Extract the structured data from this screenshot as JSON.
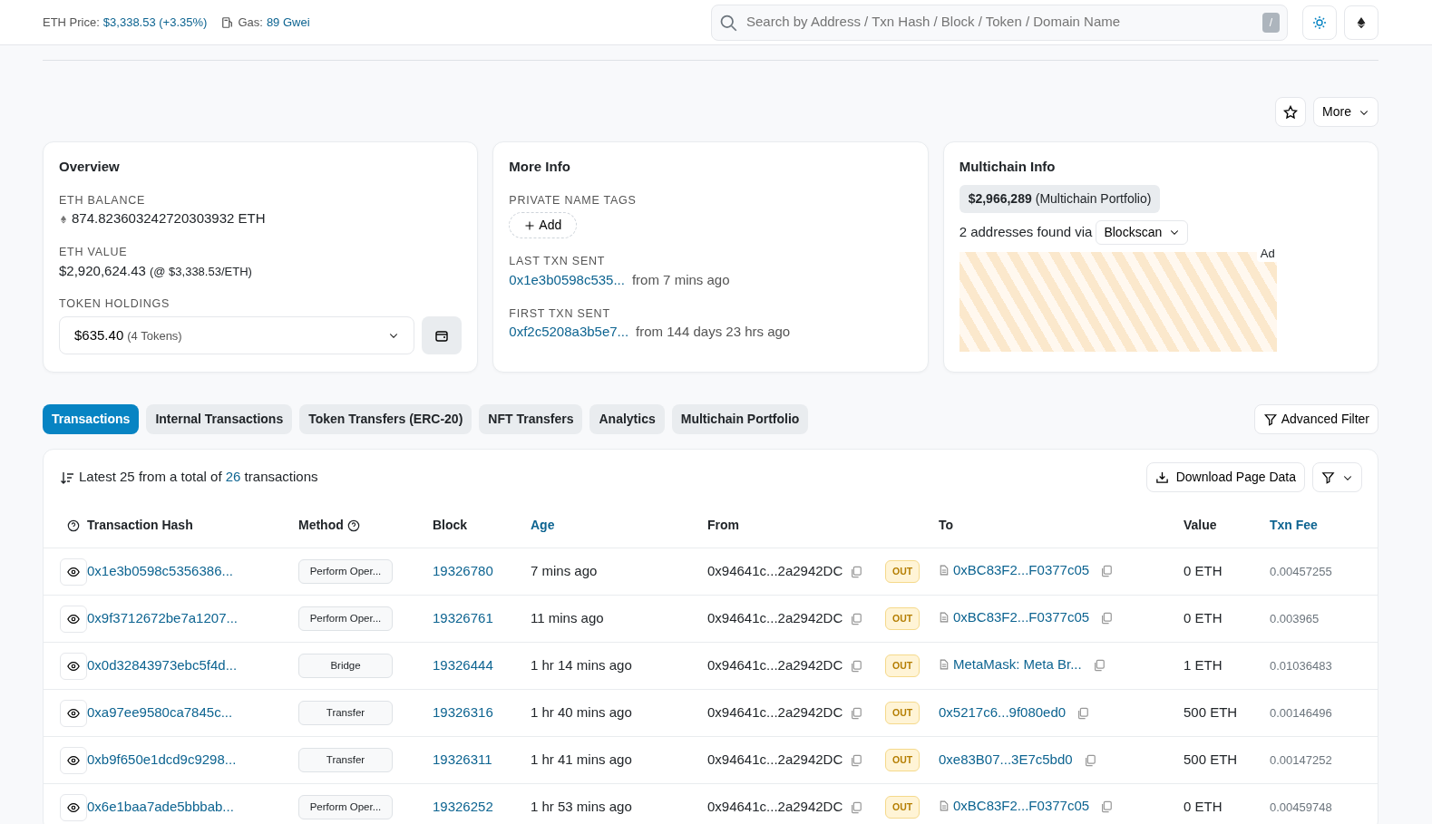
{
  "topbar": {
    "eth_price_label": "ETH Price:",
    "eth_price": "$3,338.53 (+3.35%)",
    "gas_label": "Gas:",
    "gas": "89 Gwei",
    "search": {
      "placeholder": "Search by Address / Txn Hash / Block / Token / Domain Name",
      "shortcut": "/"
    }
  },
  "actions": {
    "more": "More"
  },
  "overview": {
    "title": "Overview",
    "balance_label": "ETH BALANCE",
    "balance": "874.823603242720303932 ETH",
    "value_label": "ETH VALUE",
    "value": "$2,920,624.43",
    "value_rate": "(@ $3,338.53/ETH)",
    "holdings_label": "TOKEN HOLDINGS",
    "holdings": "$635.40",
    "holdings_count": "(4 Tokens)"
  },
  "more_info": {
    "title": "More Info",
    "tags_label": "PRIVATE NAME TAGS",
    "add": "Add",
    "last_label": "LAST TXN SENT",
    "last_hash": "0x1e3b0598c535...",
    "last_age": "from 7 mins ago",
    "first_label": "FIRST TXN SENT",
    "first_hash": "0xf2c5208a3b5e7...",
    "first_age": "from 144 days 23 hrs ago"
  },
  "multichain": {
    "title": "Multichain Info",
    "portfolio_value": "$2,966,289",
    "portfolio_label": "(Multichain Portfolio)",
    "found": "2 addresses found via",
    "source": "Blockscan",
    "ad_label": "Ad"
  },
  "tabs": [
    {
      "label": "Transactions",
      "selected": true
    },
    {
      "label": "Internal Transactions",
      "selected": false
    },
    {
      "label": "Token Transfers (ERC-20)",
      "selected": false
    },
    {
      "label": "NFT Transfers",
      "selected": false
    },
    {
      "label": "Analytics",
      "selected": false
    },
    {
      "label": "Multichain Portfolio",
      "selected": false
    }
  ],
  "advanced_filter": "Advanced Filter",
  "table": {
    "summary_prefix": "Latest 25 from a total of",
    "summary_count": "26",
    "summary_suffix": "transactions",
    "download": "Download Page Data",
    "columns": [
      {
        "label": "Transaction Hash",
        "link": false
      },
      {
        "label": "Method",
        "link": false
      },
      {
        "label": "Block",
        "link": false
      },
      {
        "label": "Age",
        "link": true
      },
      {
        "label": "From",
        "link": false
      },
      {
        "label": "To",
        "link": false
      },
      {
        "label": "Value",
        "link": false
      },
      {
        "label": "Txn Fee",
        "link": true
      }
    ],
    "rows": [
      {
        "hash": "0x1e3b0598c5356386...",
        "method": "Perform Oper...",
        "block": "19326780",
        "age": "7 mins ago",
        "from": "0x94641c...2a2942DC",
        "direction": "OUT",
        "to": "0xBC83F2...F0377c05",
        "to_contract": true,
        "value": "0 ETH",
        "fee": "0.00457255"
      },
      {
        "hash": "0x9f3712672be7a1207...",
        "method": "Perform Oper...",
        "block": "19326761",
        "age": "11 mins ago",
        "from": "0x94641c...2a2942DC",
        "direction": "OUT",
        "to": "0xBC83F2...F0377c05",
        "to_contract": true,
        "value": "0 ETH",
        "fee": "0.003965"
      },
      {
        "hash": "0x0d32843973ebc5f4d...",
        "method": "Bridge",
        "block": "19326444",
        "age": "1 hr 14 mins ago",
        "from": "0x94641c...2a2942DC",
        "direction": "OUT",
        "to": "MetaMask: Meta Br...",
        "to_contract": true,
        "value": "1 ETH",
        "fee": "0.01036483"
      },
      {
        "hash": "0xa97ee9580ca7845c...",
        "method": "Transfer",
        "block": "19326316",
        "age": "1 hr 40 mins ago",
        "from": "0x94641c...2a2942DC",
        "direction": "OUT",
        "to": "0x5217c6...9f080ed0",
        "to_contract": false,
        "value": "500 ETH",
        "fee": "0.00146496"
      },
      {
        "hash": "0xb9f650e1dcd9c9298...",
        "method": "Transfer",
        "block": "19326311",
        "age": "1 hr 41 mins ago",
        "from": "0x94641c...2a2942DC",
        "direction": "OUT",
        "to": "0xe83B07...3E7c5bd0",
        "to_contract": false,
        "value": "500 ETH",
        "fee": "0.00147252"
      },
      {
        "hash": "0x6e1baa7ade5bbbab...",
        "method": "Perform Oper...",
        "block": "19326252",
        "age": "1 hr 53 mins ago",
        "from": "0x94641c...2a2942DC",
        "direction": "OUT",
        "to": "0xBC83F2...F0377c05",
        "to_contract": true,
        "value": "0 ETH",
        "fee": "0.00459748"
      }
    ]
  }
}
